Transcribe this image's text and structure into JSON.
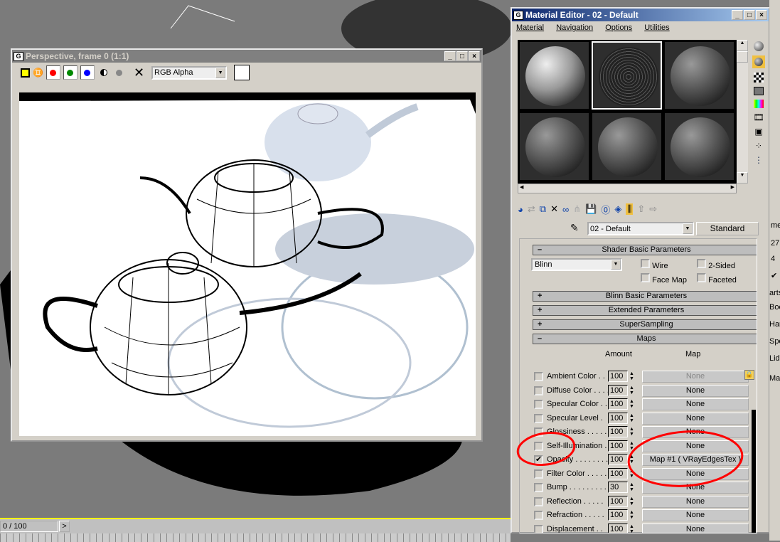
{
  "viewport": {
    "timeline": "0 / 100",
    "next_label": ">"
  },
  "perspective": {
    "title": "Perspective, frame 0 (1:1)",
    "channel": "RGB Alpha",
    "icons": [
      "save-icon",
      "clone-icon",
      "red-channel-icon",
      "green-channel-icon",
      "blue-channel-icon",
      "mono-icon",
      "alpha-icon",
      "clear-icon"
    ],
    "colors": {
      "red": "#ff0000",
      "green": "#008000",
      "blue": "#0000ff"
    }
  },
  "material_editor": {
    "title": "Material Editor - 02 - Default",
    "menu": [
      "Material",
      "Navigation",
      "Options",
      "Utilities"
    ],
    "material_name": "02 - Default",
    "material_type": "Standard",
    "rollouts": {
      "shader": "Shader Basic Parameters",
      "blinn": "Blinn Basic Parameters",
      "extended": "Extended Parameters",
      "supersampling": "SuperSampling",
      "maps": "Maps"
    },
    "shader": {
      "type": "Blinn",
      "wire": "Wire",
      "two_sided": "2-Sided",
      "face_map": "Face Map",
      "faceted": "Faceted"
    },
    "maps_header": {
      "amount": "Amount",
      "map": "Map"
    },
    "maps": [
      {
        "label": "Ambient Color . . .",
        "amount": "100",
        "map": "None",
        "checked": false,
        "disabled": true
      },
      {
        "label": "Diffuse Color . . . .",
        "amount": "100",
        "map": "None",
        "checked": false
      },
      {
        "label": "Specular Color  . .",
        "amount": "100",
        "map": "None",
        "checked": false
      },
      {
        "label": "Specular Level  .",
        "amount": "100",
        "map": "None",
        "checked": false
      },
      {
        "label": "Glossiness  . . . . .",
        "amount": "100",
        "map": "None",
        "checked": false
      },
      {
        "label": "Self-Illumination .",
        "amount": "100",
        "map": "None",
        "checked": false
      },
      {
        "label": "Opacity . . . . . . . .",
        "amount": "100",
        "map": "Map #1  ( VRayEdgesTex )",
        "checked": true
      },
      {
        "label": "Filter Color  . . . . .",
        "amount": "100",
        "map": "None",
        "checked": false
      },
      {
        "label": "Bump  . . . . . . . . .",
        "amount": "30",
        "map": "None",
        "checked": false
      },
      {
        "label": "Reflection  . . . . .",
        "amount": "100",
        "map": "None",
        "checked": false
      },
      {
        "label": "Refraction  . . . . .",
        "amount": "100",
        "map": "None",
        "checked": false
      },
      {
        "label": "Displacement  . .",
        "amount": "100",
        "map": "None",
        "checked": false
      }
    ],
    "annotation_color": "#ff0000"
  },
  "right_panel": {
    "fragments": [
      "me",
      "27",
      "4",
      "arts",
      "Boc",
      "Har",
      "Spo",
      "Lid",
      "Map"
    ]
  }
}
